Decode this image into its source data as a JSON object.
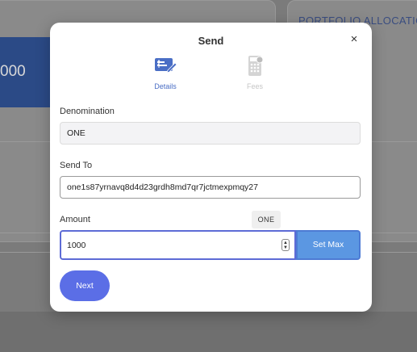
{
  "background": {
    "balance_partial": "000",
    "portfolio_heading": "PORTFOLIO ALLOCATION"
  },
  "modal": {
    "title": "Send",
    "close_symbol": "×",
    "steps": [
      {
        "label": "Details",
        "icon": "payment-form-icon",
        "state": "active",
        "color": "#4a6ec5"
      },
      {
        "label": "Fees",
        "icon": "calculator-icon",
        "state": "inactive",
        "color": "#c6c6c6"
      }
    ],
    "denomination": {
      "label": "Denomination",
      "value": "ONE"
    },
    "send_to": {
      "label": "Send To",
      "value": "one1s87yrnavq8d4d23grdh8md7qr7jctmexpmqy27"
    },
    "amount": {
      "label": "Amount",
      "currency": "ONE",
      "value": "1000"
    },
    "set_max_label": "Set Max",
    "next_label": "Next"
  },
  "colors": {
    "accent": "#5b6ee6",
    "set_max": "#5b97e2",
    "active_step": "#4a6ec5"
  }
}
